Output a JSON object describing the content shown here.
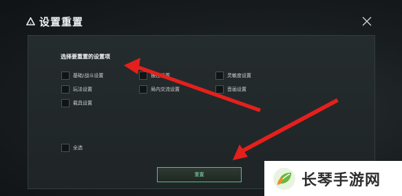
{
  "dialog": {
    "title": "设置重置",
    "heading": "选择要重置的设置项",
    "options": [
      {
        "label": "基础/战斗设置",
        "checked": false
      },
      {
        "label": "操控设置",
        "checked": false
      },
      {
        "label": "灵敏度设置",
        "checked": false
      },
      {
        "label": "玩法设置",
        "checked": false
      },
      {
        "label": "局内交流设置",
        "checked": false
      },
      {
        "label": "音画设置",
        "checked": false
      },
      {
        "label": "载具设置",
        "checked": false
      }
    ],
    "select_all": {
      "label": "全选",
      "checked": false
    },
    "reset_label": "重置"
  },
  "watermark": {
    "text": "长琴手游网"
  },
  "colors": {
    "accent": "#5fbf8a",
    "annotation_arrow": "#e5201c"
  }
}
